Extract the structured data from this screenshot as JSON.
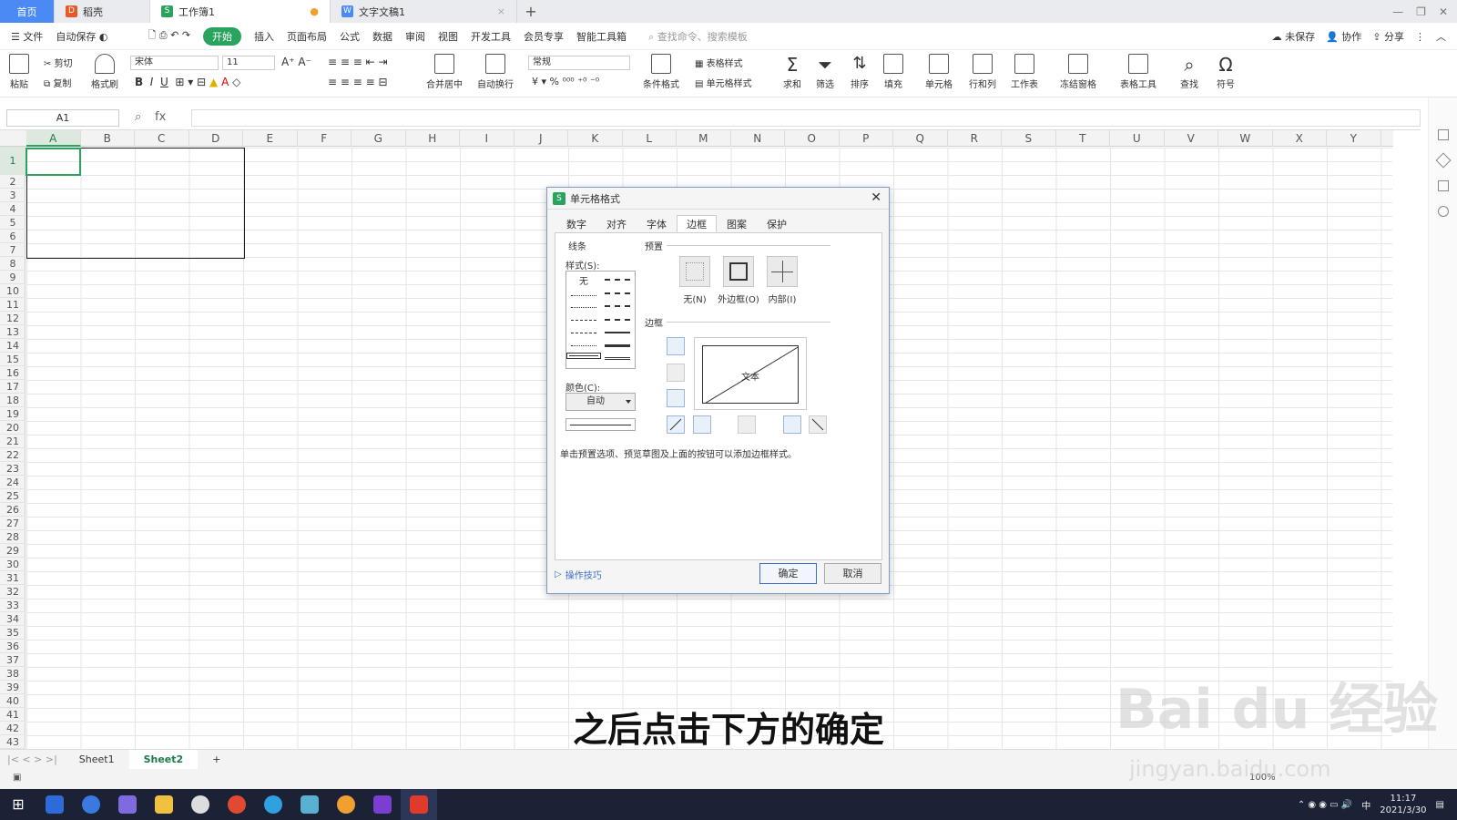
{
  "tabs": {
    "home": "首页",
    "docer": "稻壳",
    "workbook": "工作簿1",
    "writer": "文字文稿1",
    "new_tab": "+"
  },
  "menu": {
    "file": "文件",
    "autosave": "自动保存",
    "start": "开始",
    "insert": "插入",
    "page_layout": "页面布局",
    "formula": "公式",
    "data": "数据",
    "review": "审阅",
    "view": "视图",
    "dev": "开发工具",
    "member": "会员专享",
    "smart": "智能工具箱",
    "search": "查找命令、搜索模板",
    "unsaved": "未保存",
    "collab": "协作",
    "share": "分享"
  },
  "ribbon": {
    "paste": "粘贴",
    "cut": "剪切",
    "copy": "复制",
    "format_painter": "格式刷",
    "font": "宋体",
    "size": "11",
    "merge": "合并居中",
    "wrap": "自动换行",
    "numfmt": "常规",
    "cond_fmt": "条件格式",
    "table_style": "表格样式",
    "cell_style": "单元格样式",
    "sum": "求和",
    "filter": "筛选",
    "sort": "排序",
    "fill": "填充",
    "cell": "单元格",
    "rowcol": "行和列",
    "sheet": "工作表",
    "freeze": "冻结窗格",
    "tabletools": "表格工具",
    "find": "查找",
    "symbol": "符号"
  },
  "formula_bar": {
    "name_box": "A1",
    "fx": "fx"
  },
  "columns": [
    "A",
    "B",
    "C",
    "D",
    "E",
    "F",
    "G",
    "H",
    "I",
    "J",
    "K",
    "L",
    "M",
    "N",
    "O",
    "P",
    "Q",
    "R",
    "S",
    "T",
    "U",
    "V",
    "W",
    "X",
    "Y"
  ],
  "rows": [
    "1",
    "2",
    "3",
    "4",
    "5",
    "6",
    "7",
    "8",
    "9",
    "10",
    "11",
    "12",
    "13",
    "14",
    "15",
    "16",
    "17",
    "18",
    "19",
    "20",
    "21",
    "22",
    "23",
    "24",
    "25",
    "26",
    "27",
    "28",
    "29",
    "30",
    "31",
    "32",
    "33",
    "34",
    "35",
    "36",
    "37",
    "38",
    "39",
    "40",
    "41",
    "42",
    "43"
  ],
  "sheets": {
    "sheet1": "Sheet1",
    "sheet2": "Sheet2"
  },
  "dialog": {
    "title": "单元格格式",
    "tabs": [
      "数字",
      "对齐",
      "字体",
      "边框",
      "图案",
      "保护"
    ],
    "active_tab": "边框",
    "line_group": "线条",
    "style_label": "样式(S):",
    "style_none": "无",
    "color_label": "颜色(C):",
    "color_value": "自动",
    "preset_group": "预置",
    "preset_none": "无(N)",
    "preset_outline": "外边框(O)",
    "preset_inside": "内部(I)",
    "border_group": "边框",
    "preview_text": "文本",
    "hint": "单击预置选项、预览草图及上面的按钮可以添加边框样式。",
    "tips": "操作技巧",
    "ok": "确定",
    "cancel": "取消"
  },
  "status": {
    "zoom": "100%"
  },
  "taskbar": {
    "time": "11:17",
    "date": "2021/3/30",
    "ime": "中"
  },
  "subtitle": "之后点击下方的确定",
  "watermark": {
    "main": "Bai du 经验",
    "url": "jingyan.baidu.com"
  }
}
